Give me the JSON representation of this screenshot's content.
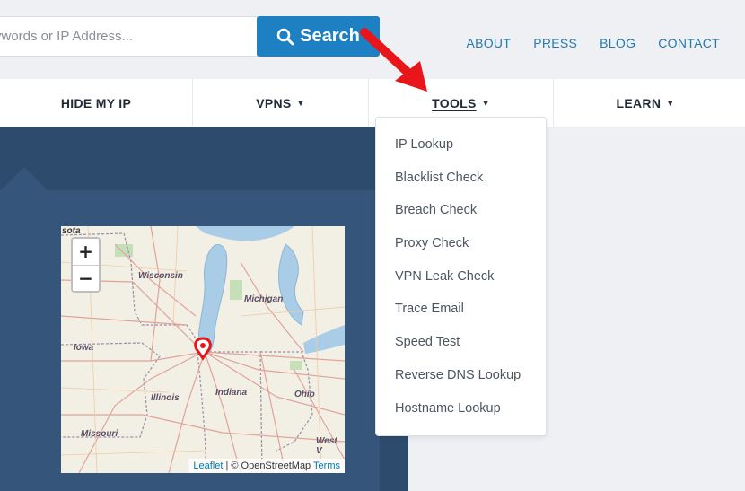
{
  "search": {
    "placeholder": "ywords or IP Address...",
    "button_label": "Search"
  },
  "top_links": [
    "ABOUT",
    "PRESS",
    "BLOG",
    "CONTACT"
  ],
  "nav": {
    "hide_my_ip": "HIDE MY IP",
    "vpns": "VPNS",
    "tools": "TOOLS",
    "learn": "LEARN",
    "caret": "▼"
  },
  "tools_menu": [
    "IP Lookup",
    "Blacklist Check",
    "Breach Check",
    "Proxy Check",
    "VPN Leak Check",
    "Trace Email",
    "Speed Test",
    "Reverse DNS Lookup",
    "Hostname Lookup"
  ],
  "map": {
    "zoom_in": "+",
    "zoom_out": "−",
    "labels": {
      "sota": "sota",
      "wisconsin": "Wisconsin",
      "michigan": "Michigan",
      "iowa": "Iowa",
      "illinois": "Illinois",
      "indiana": "Indiana",
      "ohio": "Ohio",
      "missouri": "Missouri",
      "west_v": "West V"
    },
    "attribution": {
      "leaflet": "Leaflet",
      "sep": " | © OpenStreetMap ",
      "terms": "Terms"
    }
  },
  "colors": {
    "accent": "#1c80c3",
    "nav_panel": "#2d4b6c",
    "annotation_arrow": "#e8161b"
  }
}
